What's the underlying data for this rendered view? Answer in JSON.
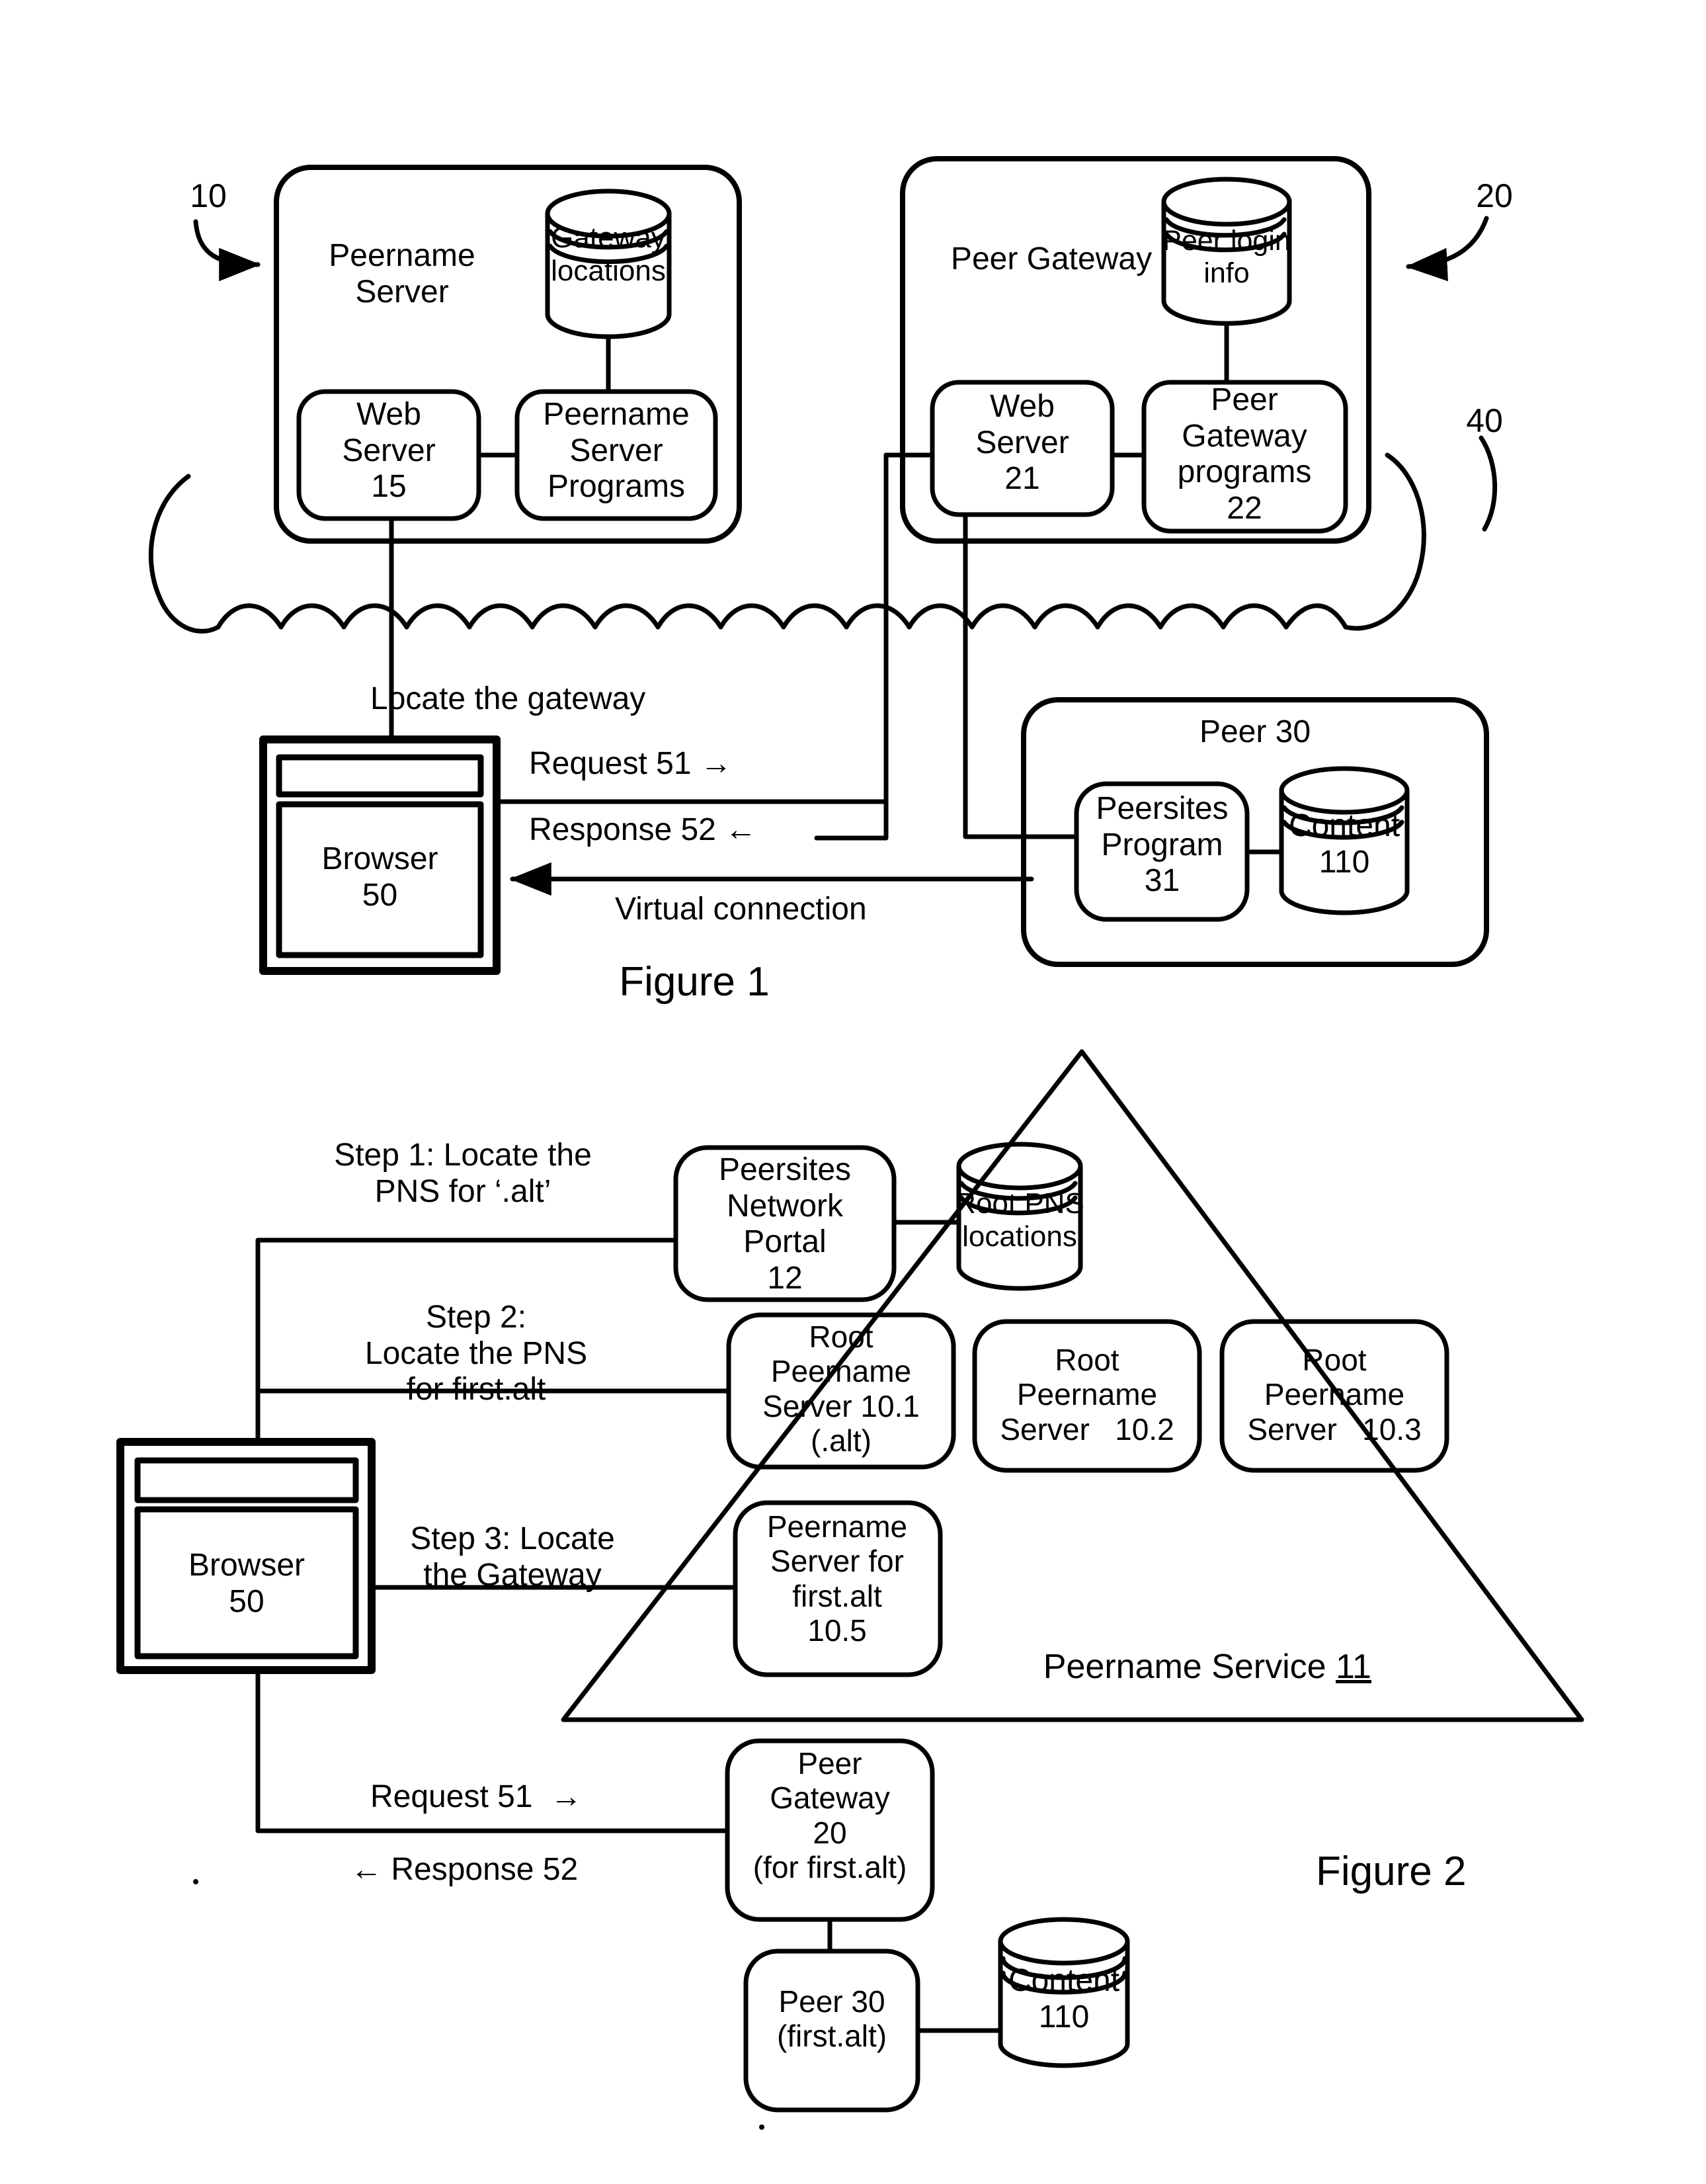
{
  "figures": [
    {
      "id": "figure-1",
      "caption": "Figure 1",
      "refs": {
        "system": "10",
        "gateway": "20",
        "network": "40"
      },
      "nodes": {
        "peername_server_container": "Peername\nServer",
        "gateway_locations_db": "Gateway\nlocations",
        "web_server_15": "Web\nServer\n15",
        "peername_server_programs": "Peername\nServer\nPrograms",
        "peer_gateway_container": "Peer Gateway",
        "peer_login_info_db": "Peer login\ninfo",
        "web_server_21": "Web\nServer\n21",
        "peer_gateway_programs_22": "Peer\nGateway\nprograms\n22",
        "browser_50": "Browser\n50",
        "peer_30_title": "Peer 30",
        "peersites_program_31": "Peersites\nProgram\n31",
        "content_110_db": "Content\n110"
      },
      "flows": {
        "locate_gateway": "Locate the gateway",
        "request_51": "Request 51 →",
        "response_52": "Response 52 ←",
        "virtual_connection": "Virtual connection"
      }
    },
    {
      "id": "figure-2",
      "caption": "Figure 2",
      "nodes": {
        "peersites_network_portal_12": "Peersites\nNetwork\nPortal\n12",
        "root_pns_locations_db": "Root PNS\nlocations",
        "root_peername_server_101": "Root\nPeername\nServer 10.1\n(.alt)",
        "root_peername_server_102": "Root\nPeername\nServer   10.2",
        "root_peername_server_103": "Root\nPeername\nServer   10.3",
        "peername_server_first_alt_105": "Peername\nServer for\nfirst.alt\n10.5",
        "browser_50": "Browser\n50",
        "peer_gateway_20": "Peer\nGateway\n20\n(for first.alt)",
        "peer_30_first_alt": "Peer 30\n(first.alt)",
        "content_110_db": "Content\n110"
      },
      "service_label": {
        "text": "Peername Service ",
        "ref": "11"
      },
      "steps": {
        "step1": "Step 1: Locate the\nPNS for ‘.alt’",
        "step2": "Step 2:\nLocate the PNS\nfor first.alt",
        "step3": "Step 3: Locate\nthe Gateway"
      },
      "flows": {
        "request_51": "Request 51  →",
        "response_52": "← Response 52"
      }
    }
  ],
  "colors": {
    "ink": "#000000",
    "paper": "#ffffff"
  }
}
